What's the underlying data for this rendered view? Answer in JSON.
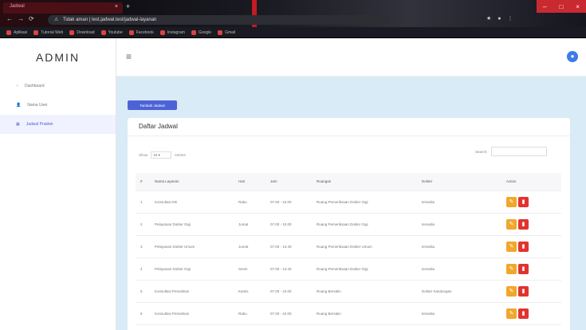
{
  "browser": {
    "tab_title": "Jadwal",
    "address_prefix": "Tidak aman",
    "address_url": "test.jadwal.test/jadwal-layanan",
    "bookmarks": [
      "Aplikasi",
      "Tutorial Web",
      "Download",
      "Youtube",
      "Facebook",
      "Instagram",
      "Google",
      "Gmail"
    ]
  },
  "sidebar": {
    "brand": "ADMIN",
    "items": [
      {
        "label": "Dashboard",
        "icon": "dashboard-icon"
      },
      {
        "label": "Nama User",
        "icon": "users-icon"
      },
      {
        "label": "Jadwal Praktek",
        "icon": "calendar-icon"
      }
    ]
  },
  "main": {
    "add_button": "Tambah Jadwal",
    "card_title": "Daftar Jadwal",
    "show_label": "Show",
    "show_value": "10",
    "entries_label": "entries",
    "search_label": "Search:",
    "table": {
      "headers": [
        "#",
        "Nama Layanan",
        "Hari",
        "Jam",
        "Ruangan",
        "Dokter",
        "Action"
      ],
      "rows": [
        [
          "1",
          "Konsultasi KB",
          "Rabu",
          "07.00 - 10.00",
          "Ruang Pemeriksaan Dokter Gigi",
          "tersedia"
        ],
        [
          "2",
          "Pelayanan Dokter Gigi",
          "Jumat",
          "07.00 - 10.00",
          "Ruang Pemeriksaan Dokter Gigi",
          "tersedia"
        ],
        [
          "3",
          "Pelayanan Dokter Umum",
          "Jumat",
          "07.00 - 13.40",
          "Ruang Pemeriksaan Dokter Umum",
          "tersedia"
        ],
        [
          "4",
          "Pelayanan Dokter Gigi",
          "Senin",
          "07.00 - 13.40",
          "Ruang Pemeriksaan Dokter Gigi",
          "tersedia"
        ],
        [
          "5",
          "Konsultasi Persalinan",
          "Kamis",
          "07.00 - 10.00",
          "Ruang Bersalin",
          "Dokter Kandungan"
        ],
        [
          "6",
          "Konsultasi Persalinan",
          "Rabu",
          "07.00 - 10.00",
          "Ruang Bersalin",
          "tersedia"
        ]
      ]
    }
  }
}
